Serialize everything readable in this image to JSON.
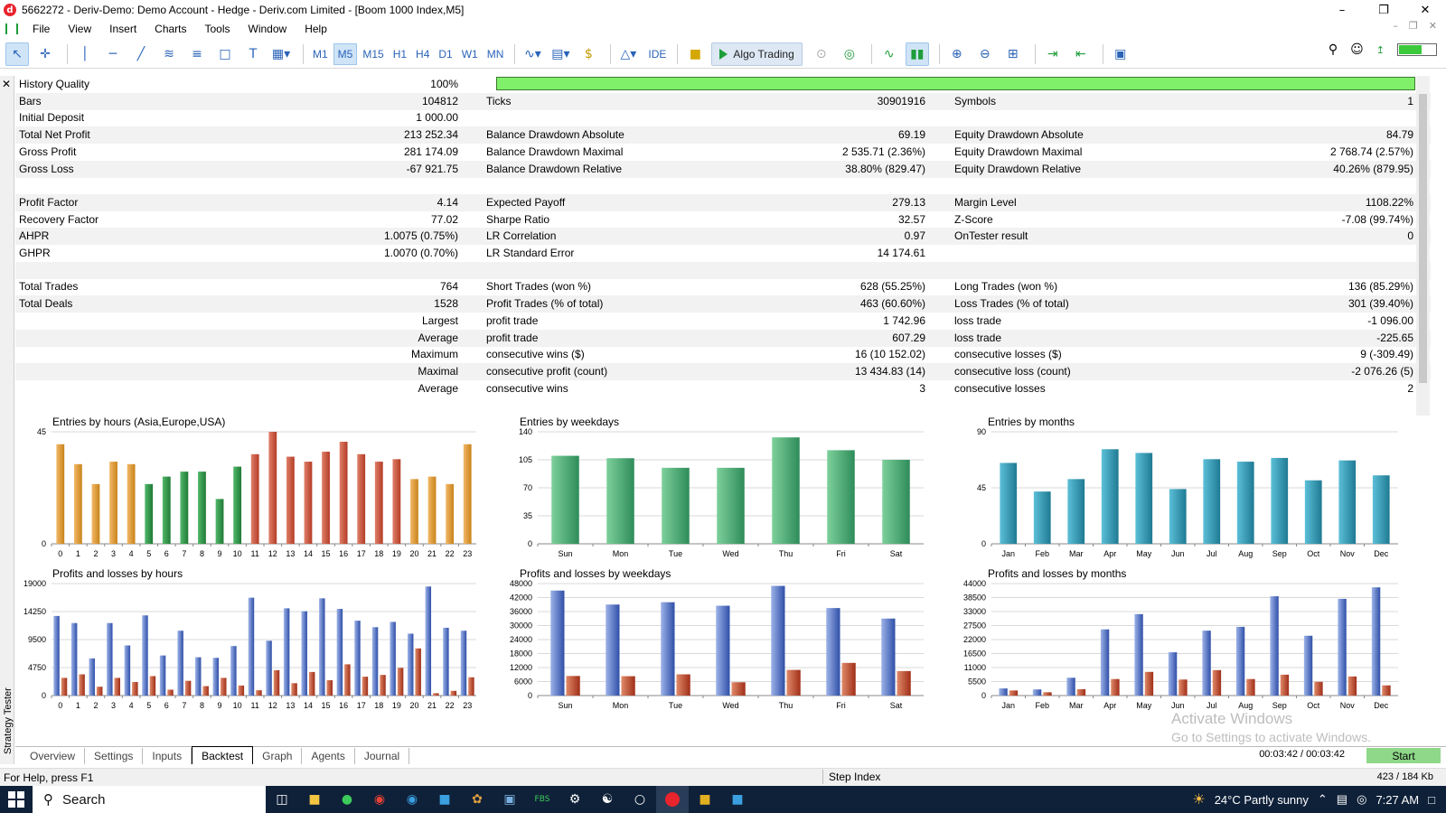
{
  "window": {
    "title": "5662272 - Deriv-Demo: Demo Account - Hedge - Deriv.com Limited - [Boom 1000 Index,M5]",
    "logo": "d"
  },
  "menu": [
    "File",
    "View",
    "Insert",
    "Charts",
    "Tools",
    "Window",
    "Help"
  ],
  "toolbar": {
    "timeframes": [
      "M1",
      "M5",
      "M15",
      "H1",
      "H4",
      "D1",
      "W1",
      "MN"
    ],
    "selected_timeframe": "M5",
    "ide_label": "IDE",
    "algo_label": "Algo Trading"
  },
  "sidebar": {
    "label": "Strategy Tester"
  },
  "report": {
    "history_quality": {
      "label": "History Quality",
      "value": "100%"
    },
    "rows": [
      [
        [
          "Bars",
          "104812"
        ],
        [
          "Ticks",
          "30901916"
        ],
        [
          "Symbols",
          "1"
        ]
      ],
      [
        [
          "Initial Deposit",
          "1 000.00"
        ],
        null,
        null
      ],
      [
        [
          "Total Net Profit",
          "213 252.34"
        ],
        [
          "Balance Drawdown Absolute",
          "69.19"
        ],
        [
          "Equity Drawdown Absolute",
          "84.79"
        ]
      ],
      [
        [
          "Gross Profit",
          "281 174.09"
        ],
        [
          "Balance Drawdown Maximal",
          "2 535.71 (2.36%)"
        ],
        [
          "Equity Drawdown Maximal",
          "2 768.74 (2.57%)"
        ]
      ],
      [
        [
          "Gross Loss",
          "-67 921.75"
        ],
        [
          "Balance Drawdown Relative",
          "38.80% (829.47)"
        ],
        [
          "Equity Drawdown Relative",
          "40.26% (879.95)"
        ]
      ],
      [
        null,
        null,
        null
      ],
      [
        [
          "Profit Factor",
          "4.14"
        ],
        [
          "Expected Payoff",
          "279.13"
        ],
        [
          "Margin Level",
          "1108.22%"
        ]
      ],
      [
        [
          "Recovery Factor",
          "77.02"
        ],
        [
          "Sharpe Ratio",
          "32.57"
        ],
        [
          "Z-Score",
          "-7.08 (99.74%)"
        ]
      ],
      [
        [
          "AHPR",
          "1.0075 (0.75%)"
        ],
        [
          "LR Correlation",
          "0.97"
        ],
        [
          "OnTester result",
          "0"
        ]
      ],
      [
        [
          "GHPR",
          "1.0070 (0.70%)"
        ],
        [
          "LR Standard Error",
          "14 174.61"
        ],
        null
      ],
      [
        null,
        null,
        null
      ],
      [
        [
          "Total Trades",
          "764"
        ],
        [
          "Short Trades (won %)",
          "628 (55.25%)"
        ],
        [
          "Long Trades (won %)",
          "136 (85.29%)"
        ]
      ],
      [
        [
          "Total Deals",
          "1528"
        ],
        [
          "Profit Trades (% of total)",
          "463 (60.60%)"
        ],
        [
          "Loss Trades (% of total)",
          "301 (39.40%)"
        ]
      ],
      [
        [
          "",
          "Largest"
        ],
        [
          "profit trade",
          "1 742.96"
        ],
        [
          "loss trade",
          "-1 096.00"
        ]
      ],
      [
        [
          "",
          "Average"
        ],
        [
          "profit trade",
          "607.29"
        ],
        [
          "loss trade",
          "-225.65"
        ]
      ],
      [
        [
          "",
          "Maximum"
        ],
        [
          "consecutive wins ($)",
          "16 (10 152.02)"
        ],
        [
          "consecutive losses ($)",
          "9 (-309.49)"
        ]
      ],
      [
        [
          "",
          "Maximal"
        ],
        [
          "consecutive profit (count)",
          "13 434.83 (14)"
        ],
        [
          "consecutive loss (count)",
          "-2 076.26 (5)"
        ]
      ],
      [
        [
          "",
          "Average"
        ],
        [
          "consecutive wins",
          "3"
        ],
        [
          "consecutive losses",
          "2"
        ]
      ]
    ]
  },
  "chart_data": [
    {
      "type": "bar",
      "title": "Entries by hours (Asia,Europe,USA)",
      "categories": [
        "0",
        "1",
        "2",
        "3",
        "4",
        "5",
        "6",
        "7",
        "8",
        "9",
        "10",
        "11",
        "12",
        "13",
        "14",
        "15",
        "16",
        "17",
        "18",
        "19",
        "20",
        "21",
        "22",
        "23"
      ],
      "values": [
        40,
        32,
        24,
        33,
        32,
        24,
        27,
        29,
        29,
        18,
        31,
        36,
        45,
        35,
        33,
        37,
        41,
        36,
        33,
        34,
        26,
        27,
        24,
        40
      ],
      "ylim": [
        0,
        45
      ],
      "yticks": [
        "0",
        "45"
      ]
    },
    {
      "type": "bar",
      "title": "Entries by weekdays",
      "categories": [
        "Sun",
        "Mon",
        "Tue",
        "Wed",
        "Thu",
        "Fri",
        "Sat"
      ],
      "values": [
        110,
        107,
        95,
        95,
        133,
        117,
        105
      ],
      "ylim": [
        0,
        140
      ],
      "yticks": [
        "0",
        "35",
        "70",
        "105",
        "140"
      ]
    },
    {
      "type": "bar",
      "title": "Entries by months",
      "categories": [
        "Jan",
        "Feb",
        "Mar",
        "Apr",
        "May",
        "Jun",
        "Jul",
        "Aug",
        "Sep",
        "Oct",
        "Nov",
        "Dec"
      ],
      "values": [
        65,
        42,
        52,
        76,
        73,
        44,
        68,
        66,
        69,
        51,
        67,
        55
      ],
      "ylim": [
        0,
        90
      ],
      "yticks": [
        "0",
        "45",
        "90"
      ]
    },
    {
      "type": "bar",
      "title": "Profits and losses by hours",
      "categories": [
        "0",
        "1",
        "2",
        "3",
        "4",
        "5",
        "6",
        "7",
        "8",
        "9",
        "10",
        "11",
        "12",
        "13",
        "14",
        "15",
        "16",
        "17",
        "18",
        "19",
        "20",
        "21",
        "22",
        "23"
      ],
      "series": [
        {
          "values": [
            13500,
            12300,
            6300,
            12300,
            8500,
            13600,
            6800,
            11000,
            6500,
            6400,
            8400,
            16600,
            9300,
            14800,
            14300,
            16500,
            14700,
            12700,
            11600,
            12500,
            10500,
            18500,
            11500,
            11000
          ]
        },
        {
          "values": [
            3000,
            3600,
            1500,
            3000,
            2300,
            3300,
            1000,
            2500,
            1600,
            3000,
            1700,
            900,
            4300,
            2100,
            4000,
            2600,
            5300,
            3200,
            3500,
            4700,
            8000,
            400,
            800,
            3100
          ]
        }
      ],
      "ylim": [
        0,
        19000
      ],
      "yticks": [
        "0",
        "4750",
        "9500",
        "14250",
        "19000"
      ]
    },
    {
      "type": "bar",
      "title": "Profits and losses by weekdays",
      "categories": [
        "Sun",
        "Mon",
        "Tue",
        "Wed",
        "Thu",
        "Fri",
        "Sat"
      ],
      "series": [
        {
          "values": [
            45000,
            39000,
            40000,
            38500,
            47000,
            37500,
            33000
          ]
        },
        {
          "values": [
            8400,
            8300,
            9100,
            5700,
            11000,
            14000,
            10500
          ]
        }
      ],
      "ylim": [
        0,
        48000
      ],
      "yticks": [
        "0",
        "6000",
        "12000",
        "18000",
        "24000",
        "30000",
        "36000",
        "42000",
        "48000"
      ]
    },
    {
      "type": "bar",
      "title": "Profits and losses by months",
      "categories": [
        "Jan",
        "Feb",
        "Mar",
        "Apr",
        "May",
        "Jun",
        "Jul",
        "Aug",
        "Sep",
        "Oct",
        "Nov",
        "Dec"
      ],
      "series": [
        {
          "values": [
            2800,
            2400,
            7000,
            26000,
            32000,
            17000,
            25500,
            27000,
            39000,
            23500,
            38000,
            42500
          ]
        },
        {
          "values": [
            2000,
            1300,
            2500,
            6500,
            9300,
            6300,
            10000,
            6500,
            8200,
            5400,
            7500,
            4000
          ]
        }
      ],
      "ylim": [
        0,
        44000
      ],
      "yticks": [
        "0",
        "5500",
        "11000",
        "16500",
        "22000",
        "27500",
        "33000",
        "38500",
        "44000"
      ]
    }
  ],
  "tabs": [
    "Overview",
    "Settings",
    "Inputs",
    "Backtest",
    "Graph",
    "Agents",
    "Journal"
  ],
  "active_tab": "Backtest",
  "tester": {
    "timer": "00:03:42 / 00:03:42",
    "start_label": "Start"
  },
  "status": {
    "help": "For Help, press F1",
    "symbol": "Step Index",
    "memory": "423 / 184 Kb"
  },
  "watermark": {
    "line1": "Activate Windows",
    "line2": "Go to Settings to activate Windows."
  },
  "taskbar": {
    "search_placeholder": "Search",
    "weather": "24°C  Partly sunny",
    "time": "7:27 AM"
  },
  "colors": {
    "hours_palette": "#e0a050",
    "green": "#3fa86c",
    "teal": "#2f9ab0",
    "blue": "#4a6fc0",
    "red": "#c24a30",
    "hq_bar": "#80ef6a"
  }
}
